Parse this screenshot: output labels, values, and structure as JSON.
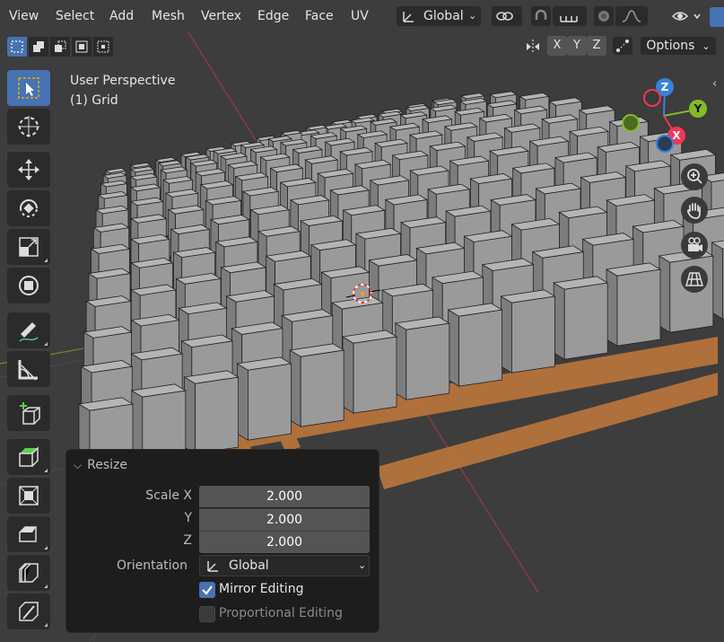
{
  "header": {
    "menu": [
      "View",
      "Select",
      "Add",
      "Mesh",
      "Vertex",
      "Edge",
      "Face",
      "UV"
    ],
    "transform_orientation": "Global",
    "options_label": "Options",
    "axes": [
      "X",
      "Y",
      "Z"
    ]
  },
  "viewport": {
    "view_name": "User Perspective",
    "object_name": "(1) Grid"
  },
  "gizmo": {
    "axes": {
      "z": "Z",
      "y": "Y",
      "x": "X"
    }
  },
  "panel": {
    "title": "Resize",
    "scale_label": "Scale X",
    "y_label": "Y",
    "z_label": "Z",
    "scale_x": "2.000",
    "scale_y": "2.000",
    "scale_z": "2.000",
    "orientation_label": "Orientation",
    "orientation_value": "Global",
    "mirror_editing": "Mirror Editing",
    "mirror_checked": true,
    "proportional_editing": "Proportional Editing",
    "proportional_checked": false
  },
  "colors": {
    "accent": "#4772b3",
    "selected_face": "#c37a3b",
    "x_axis": "#f13753",
    "y_axis": "#84bc24",
    "z_axis": "#3582e0"
  }
}
